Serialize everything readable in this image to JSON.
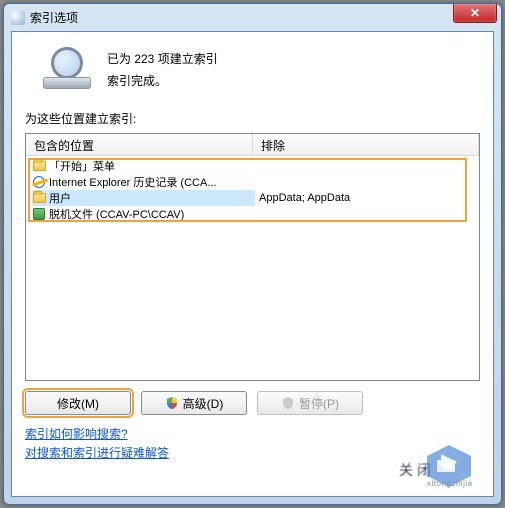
{
  "window": {
    "title": "索引选项",
    "close_glyph": "✕"
  },
  "status": {
    "line1": "已为 223 项建立索引",
    "line2": "索引完成。"
  },
  "section_label": "为这些位置建立索引:",
  "columns": {
    "included": "包含的位置",
    "excluded": "排除"
  },
  "rows": [
    {
      "icon": "folder",
      "label": "「开始」菜单",
      "excluded": ""
    },
    {
      "icon": "ie",
      "label": "Internet Explorer 历史记录 (CCA...",
      "excluded": ""
    },
    {
      "icon": "folder",
      "label": "用户",
      "excluded": "AppData; AppData",
      "selected": true
    },
    {
      "icon": "offline",
      "label": "脱机文件 (CCAV-PC\\CCAV)",
      "excluded": ""
    }
  ],
  "buttons": {
    "modify": "修改(M)",
    "advanced": "高级(D)",
    "pause": "暂停(P)"
  },
  "links": {
    "how_affect": "索引如何影响搜索?",
    "troubleshoot": "对搜索和索引进行疑难解答"
  },
  "footer_blur": "关闭"
}
